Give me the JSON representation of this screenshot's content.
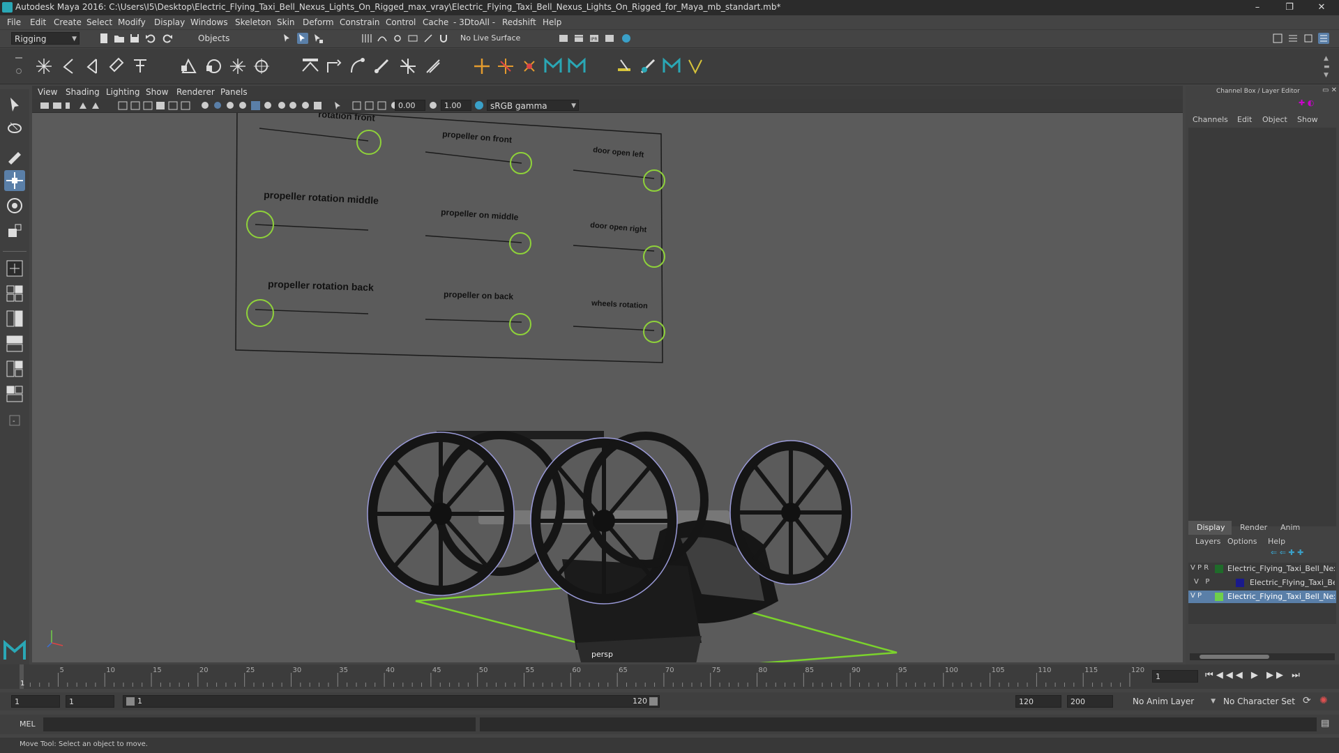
{
  "window": {
    "title": "Autodesk Maya 2016: C:\\Users\\I5\\Desktop\\Electric_Flying_Taxi_Bell_Nexus_Lights_On_Rigged_max_vray\\Electric_Flying_Taxi_Bell_Nexus_Lights_On_Rigged_for_Maya_mb_standart.mb*",
    "minimize": "–",
    "maximize": "❐",
    "close": "✕"
  },
  "menu": [
    "File",
    "Edit",
    "Create",
    "Select",
    "Modify",
    "Display",
    "Windows",
    "Skeleton",
    "Skin",
    "Deform",
    "Constrain",
    "Control",
    "Cache",
    "- 3DtoAll -",
    "Redshift",
    "Help"
  ],
  "statusline": {
    "mode": "Rigging",
    "select_mode": "Objects",
    "live_surface": "No Live Surface"
  },
  "viewport": {
    "menu": [
      "View",
      "Shading",
      "Lighting",
      "Show",
      "Renderer",
      "Panels"
    ],
    "exposure": "0.00",
    "gamma": "1.00",
    "color_space": "sRGB gamma",
    "camera_label": "persp",
    "panel_labels": [
      "rotation front",
      "propeller on front",
      "door open left",
      "propeller rotation middle",
      "propeller on middle",
      "door open right",
      "propeller rotation back",
      "propeller on back",
      "wheels rotation"
    ]
  },
  "channelbox": {
    "header": "Channel Box / Layer Editor",
    "tabs_top": [
      "Channels",
      "Edit",
      "Object",
      "Show"
    ],
    "tabs_bottom": [
      "Display",
      "Render",
      "Anim"
    ],
    "layer_menu": [
      "Layers",
      "Options",
      "Help"
    ],
    "layers": [
      {
        "flags": "V P R",
        "name": "Electric_Flying_Taxi_Bell_Nexus",
        "color": "#1f6b2a"
      },
      {
        "flags": "V   P",
        "name": "Electric_Flying_Taxi_Bell_Nexus",
        "color": "#1a1a8c"
      },
      {
        "flags": "V P",
        "name": "Electric_Flying_Taxi_Bell_Nexus",
        "color": "#6fcf4a"
      }
    ]
  },
  "timeline": {
    "ticks": [
      "5",
      "10",
      "15",
      "20",
      "25",
      "30",
      "35",
      "40",
      "45",
      "50",
      "55",
      "60",
      "65",
      "70",
      "75",
      "80",
      "85",
      "90",
      "95",
      "100",
      "105",
      "110",
      "115",
      "120"
    ],
    "current_frame": "1",
    "start_marker": "1"
  },
  "rangebar": {
    "start": "1",
    "start2": "1",
    "range_start": "1",
    "range_end": "120",
    "end": "120",
    "end2": "200",
    "anim_layer": "No Anim Layer",
    "char_set": "No Character Set"
  },
  "cmdline": {
    "label": "MEL"
  },
  "helpline": {
    "text": "Move Tool: Select an object to move."
  }
}
